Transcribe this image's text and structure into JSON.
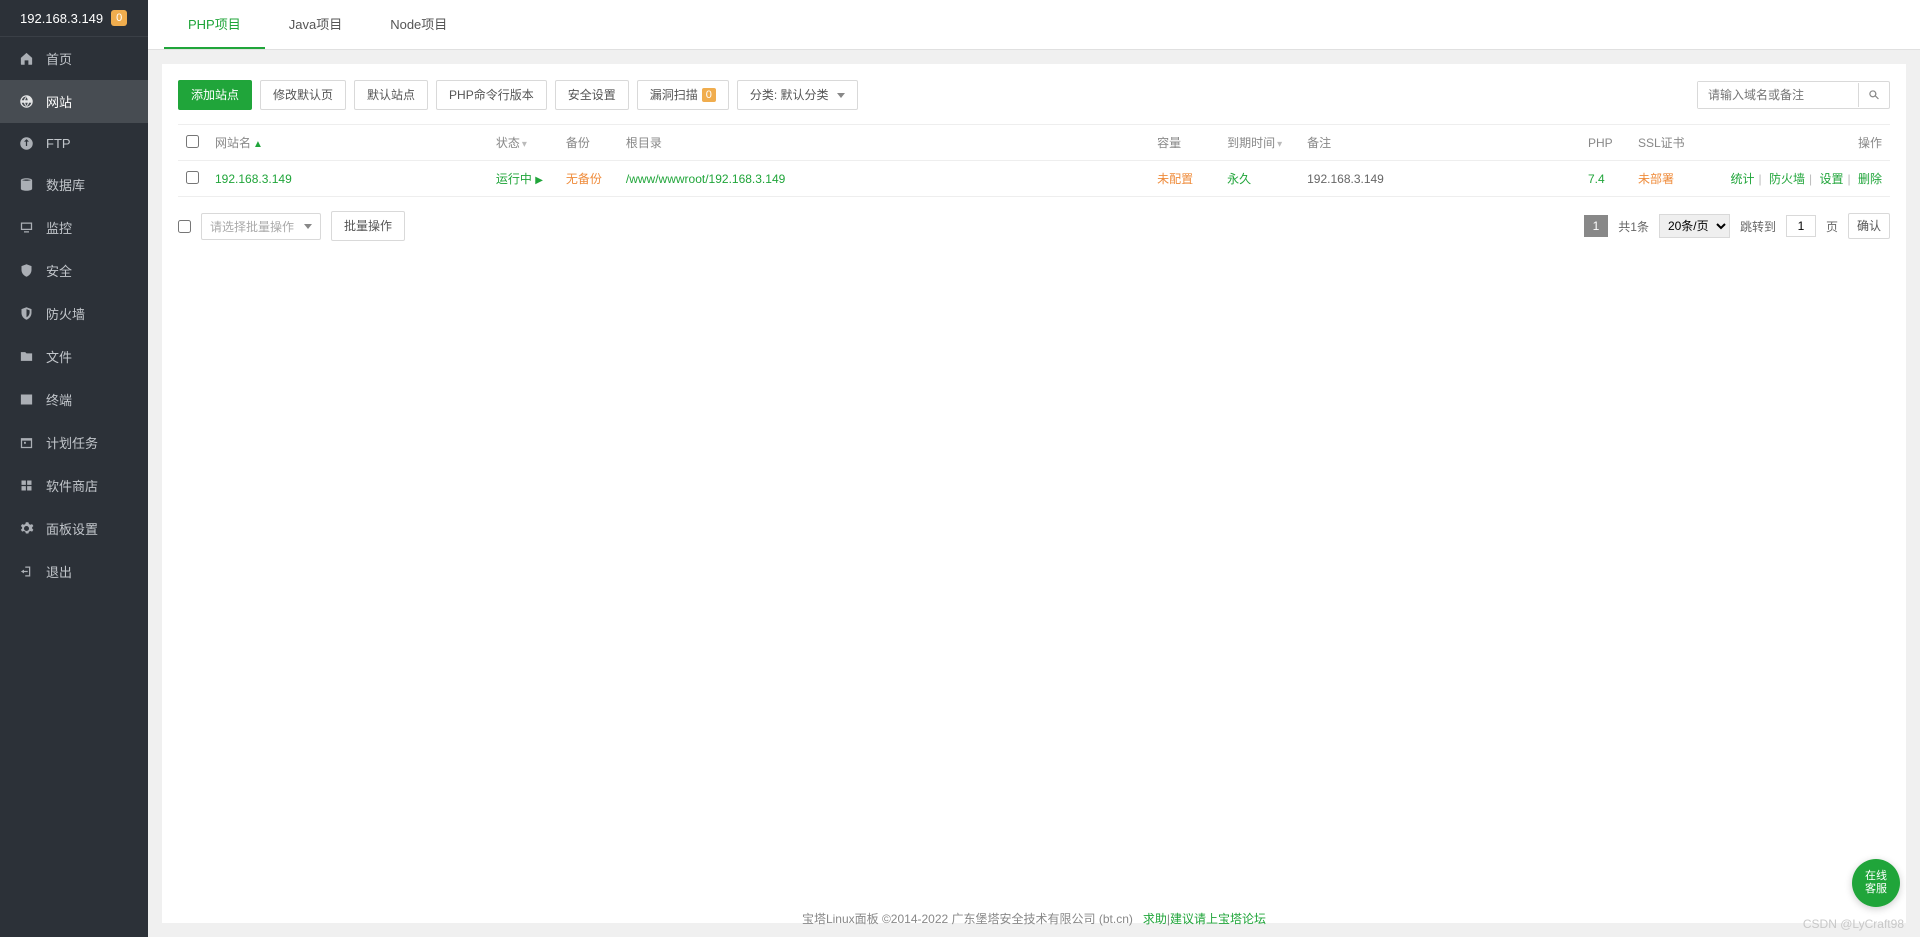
{
  "header": {
    "host": "192.168.3.149",
    "notice_count": "0"
  },
  "sidebar": {
    "items": [
      {
        "label": "首页",
        "icon": "home"
      },
      {
        "label": "网站",
        "icon": "globe",
        "active": true
      },
      {
        "label": "FTP",
        "icon": "ftp"
      },
      {
        "label": "数据库",
        "icon": "db"
      },
      {
        "label": "监控",
        "icon": "monitor"
      },
      {
        "label": "安全",
        "icon": "shield"
      },
      {
        "label": "防火墙",
        "icon": "firewall"
      },
      {
        "label": "文件",
        "icon": "folder"
      },
      {
        "label": "终端",
        "icon": "terminal"
      },
      {
        "label": "计划任务",
        "icon": "cron"
      },
      {
        "label": "软件商店",
        "icon": "store"
      },
      {
        "label": "面板设置",
        "icon": "settings"
      },
      {
        "label": "退出",
        "icon": "logout"
      }
    ]
  },
  "tabs": [
    {
      "label": "PHP项目",
      "active": true
    },
    {
      "label": "Java项目"
    },
    {
      "label": "Node项目"
    }
  ],
  "toolbar": {
    "add_site": "添加站点",
    "edit_default": "修改默认页",
    "default_site": "默认站点",
    "php_cli": "PHP命令行版本",
    "security": "安全设置",
    "vuln_scan": "漏洞扫描",
    "vuln_count": "0",
    "category": "分类: 默认分类",
    "search_placeholder": "请输入域名或备注"
  },
  "table": {
    "headers": {
      "name": "网站名",
      "status": "状态",
      "backup": "备份",
      "root": "根目录",
      "capacity": "容量",
      "expire": "到期时间",
      "remark": "备注",
      "php": "PHP",
      "ssl": "SSL证书",
      "ops": "操作"
    },
    "rows": [
      {
        "name": "192.168.3.149",
        "status": "运行中",
        "backup": "无备份",
        "root": "/www/wwwroot/192.168.3.149",
        "capacity": "未配置",
        "expire": "永久",
        "remark": "192.168.3.149",
        "php": "7.4",
        "ssl": "未部署",
        "ops": {
          "stat": "统计",
          "waf": "防火墙",
          "set": "设置",
          "del": "删除"
        }
      }
    ]
  },
  "batch": {
    "select_placeholder": "请选择批量操作",
    "exec": "批量操作"
  },
  "pagination": {
    "current": "1",
    "total": "共1条",
    "page_size": "20条/页",
    "jump_label": "跳转到",
    "jump_input": "1",
    "page_unit": "页",
    "confirm": "确认"
  },
  "footer": {
    "text": "宝塔Linux面板 ©2014-2022 广东堡塔安全技术有限公司 (bt.cn)",
    "help": "求助",
    "sep": "|",
    "forum": "建议请上宝塔论坛"
  },
  "fab": "在线\n客服",
  "watermark": "CSDN @LyCraft98"
}
